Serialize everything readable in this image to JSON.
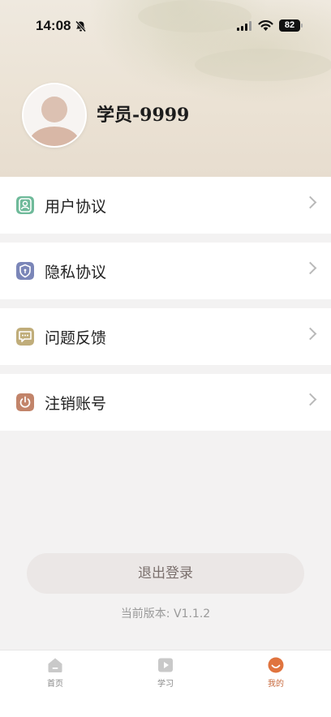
{
  "status_bar": {
    "time": "14:08",
    "battery": "82"
  },
  "profile": {
    "name": "学员-9999"
  },
  "menu": {
    "items": [
      {
        "label": "用户协议",
        "icon": "user-agreement-icon",
        "color": "#6fba9a"
      },
      {
        "label": "隐私协议",
        "icon": "privacy-shield-icon",
        "color": "#7b86b8"
      },
      {
        "label": "问题反馈",
        "icon": "feedback-icon",
        "color": "#c0ad7a"
      },
      {
        "label": "注销账号",
        "icon": "power-icon",
        "color": "#c2846a"
      }
    ]
  },
  "logout": {
    "label": "退出登录"
  },
  "version": {
    "text": "当前版本: V1.1.2"
  },
  "tabbar": {
    "tabs": [
      {
        "label": "首页",
        "icon": "home-icon",
        "active": false
      },
      {
        "label": "学习",
        "icon": "play-icon",
        "active": false
      },
      {
        "label": "我的",
        "icon": "smile-icon",
        "active": true
      }
    ]
  },
  "colors": {
    "accent": "#e0743f",
    "inactive_icon": "#c9c9c9"
  }
}
